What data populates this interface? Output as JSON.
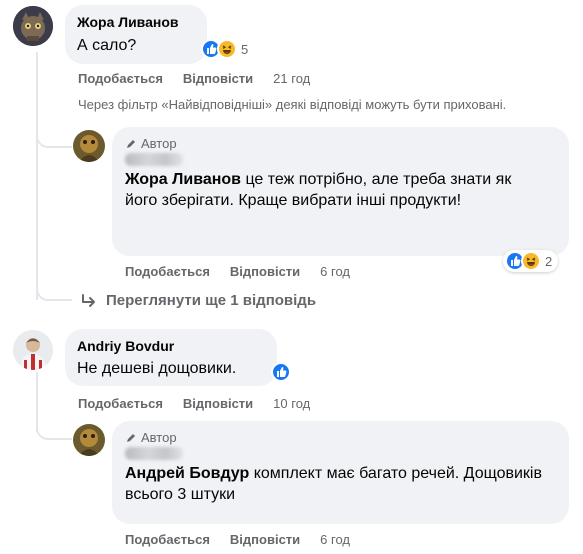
{
  "comments": [
    {
      "author": "Жора Ливанов",
      "text": "А сало?",
      "reaction_count": "5",
      "like": "Подобається",
      "reply": "Відповісти",
      "time": "21 год"
    },
    {
      "author": "Andriy Bovdur",
      "text": "Не дешеві дощовики.",
      "like": "Подобається",
      "reply": "Відповісти",
      "time": "10 год"
    }
  ],
  "filter_note": "Через фільтр «Найвідповідніші» деякі відповіді можуть бути приховані.",
  "replies": [
    {
      "badge": "Автор",
      "mention": "Жора Ливанов",
      "text": " це теж потрібно, але треба знати як його зберігати. Краще вибрати інші продукти!",
      "reaction_count": "2",
      "like": "Подобається",
      "reply": "Відповісти",
      "time": "6 год"
    },
    {
      "badge": "Автор",
      "mention": "Андрей Бовдур",
      "text": " комплект має багато речей. Дощовиків всього 3 штуки",
      "like": "Подобається",
      "reply": "Відповісти",
      "time": "6 год"
    }
  ],
  "view_more": "Переглянути ще 1 відповідь",
  "colors": {
    "bubble": "#f0f2f5",
    "meta": "#65676b",
    "like_blue": "#1877f2",
    "haha_yellow": "#f7b928"
  },
  "icons": [
    "like-reaction-icon",
    "haha-reaction-icon",
    "author-pen-icon",
    "reply-arrow-icon"
  ]
}
